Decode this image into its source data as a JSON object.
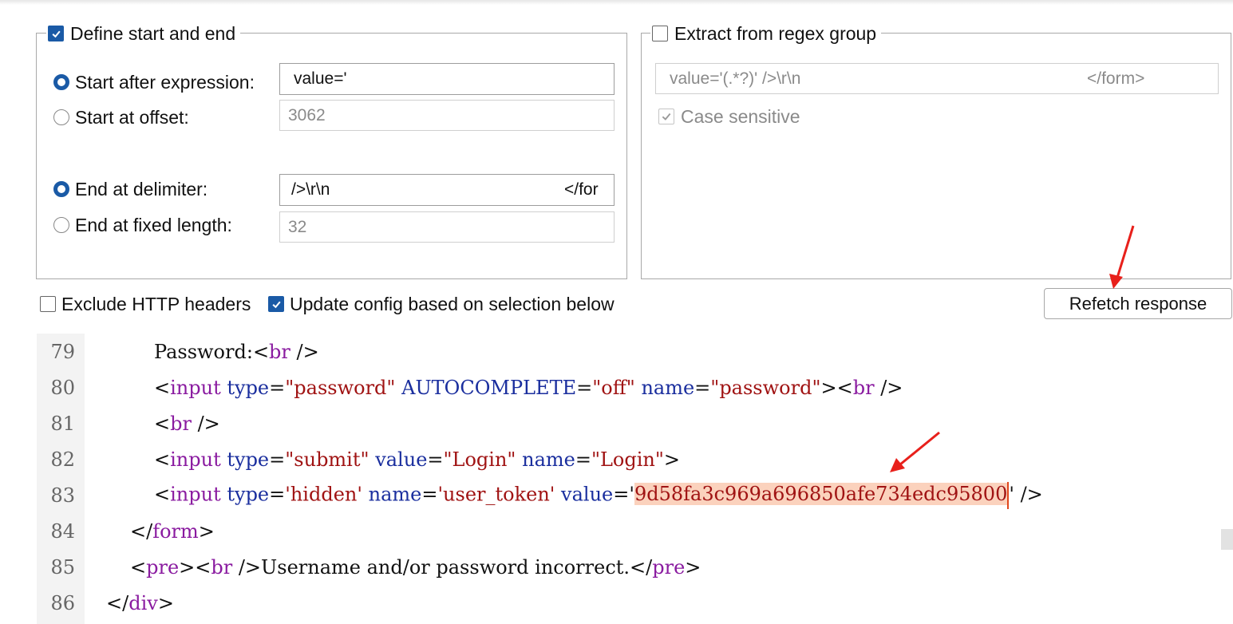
{
  "left_group": {
    "checkbox_label": "Define start and end",
    "checked": true,
    "start_after_expression": {
      "label": "Start after expression:",
      "value": "value='",
      "selected": true
    },
    "start_at_offset": {
      "label": "Start at offset:",
      "value": "3062",
      "selected": false
    },
    "end_at_delimiter": {
      "label": "End at delimiter:",
      "value_left": "/>\\r\\n",
      "value_right": "</for",
      "selected": true
    },
    "end_at_fixed_length": {
      "label": "End at fixed length:",
      "value": "32",
      "selected": false
    }
  },
  "right_group": {
    "checkbox_label": "Extract from regex group",
    "checked": false,
    "regex_left": "value='(.*?)' />\\r\\n",
    "regex_right": "</form>",
    "case_sensitive_label": "Case sensitive",
    "case_sensitive_checked": true
  },
  "options": {
    "exclude_http_headers": "Exclude HTTP headers",
    "exclude_http_headers_checked": false,
    "update_config": "Update config based on selection below",
    "update_config_checked": true,
    "refetch_button": "Refetch response"
  },
  "code": {
    "lines": [
      {
        "num": "79",
        "t": [
          "Password:",
          "<",
          "br",
          " />"
        ]
      },
      {
        "num": "80",
        "t": [
          "<",
          "input",
          " ",
          "type",
          "=",
          "\"password\"",
          " ",
          "AUTOCOMPLETE",
          "=",
          "\"off\"",
          " ",
          "name",
          "=",
          "\"password\"",
          ">",
          "<",
          "br",
          " />"
        ]
      },
      {
        "num": "81",
        "t": [
          "<",
          "br",
          " />"
        ]
      },
      {
        "num": "82",
        "t": [
          "<",
          "input",
          " ",
          "type",
          "=",
          "\"submit\"",
          " ",
          "value",
          "=",
          "\"Login\"",
          " ",
          "name",
          "=",
          "\"Login\"",
          ">"
        ]
      },
      {
        "num": "83",
        "t": [
          "<",
          "input",
          " ",
          "type",
          "=",
          "'hidden'",
          " ",
          "name",
          "=",
          "'user_token'",
          " ",
          "value",
          "=",
          "'",
          "9d58fa3c969a696850afe734edc95800",
          "'",
          " />"
        ]
      },
      {
        "num": "84",
        "t": [
          "</",
          "form",
          ">"
        ]
      },
      {
        "num": "85",
        "t": [
          "<",
          "pre",
          ">",
          "<",
          "br",
          " />",
          "Username and/or password incorrect.",
          "</",
          "pre",
          ">"
        ]
      },
      {
        "num": "86",
        "t": [
          "</",
          "div",
          ">"
        ]
      }
    ],
    "selected_token": "9d58fa3c969a696850afe734edc95800"
  },
  "colors": {
    "accent": "#1a5aa6",
    "tag": "#8a1ba0",
    "attr": "#1a2e9e",
    "value": "#a01313",
    "selection": "#fbd2bd",
    "annotation_arrow": "#e8201b"
  }
}
